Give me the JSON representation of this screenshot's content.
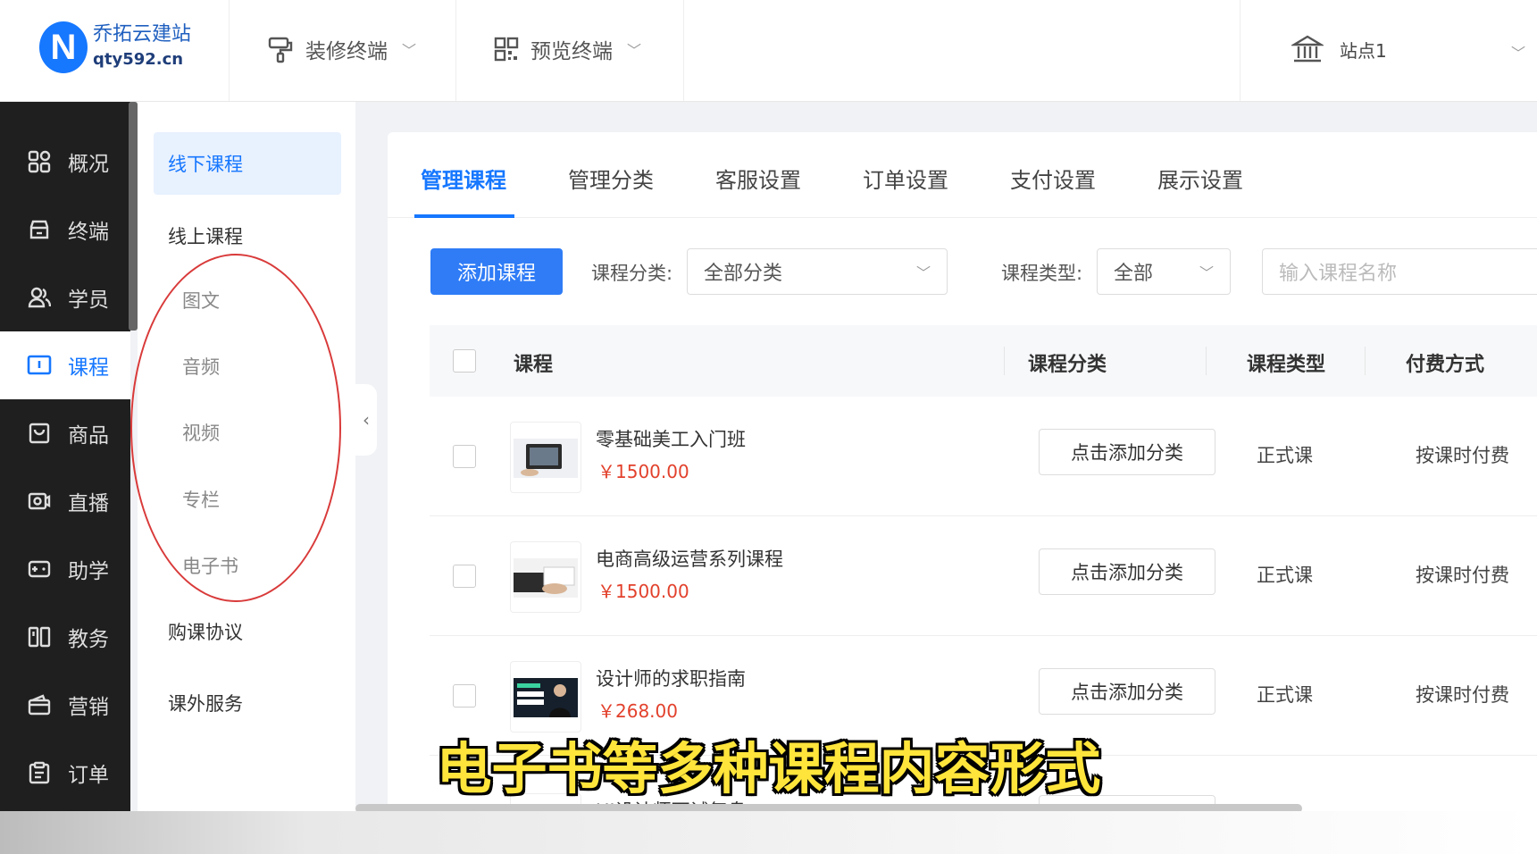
{
  "brand": {
    "name": "乔拓云建站",
    "domain": "qty592.cn",
    "mark": "N"
  },
  "topnav": [
    {
      "label": "装修终端",
      "icon": "paint-roller-icon"
    },
    {
      "label": "预览终端",
      "icon": "qr-code-icon"
    }
  ],
  "site": {
    "label": "站点1",
    "icon": "bank-icon"
  },
  "sidebar": [
    {
      "label": "概况",
      "icon": "grid-icon"
    },
    {
      "label": "终端",
      "icon": "terminal-icon"
    },
    {
      "label": "学员",
      "icon": "users-icon"
    },
    {
      "label": "课程",
      "icon": "course-icon",
      "active": true
    },
    {
      "label": "商品",
      "icon": "goods-icon"
    },
    {
      "label": "直播",
      "icon": "live-icon"
    },
    {
      "label": "助学",
      "icon": "gamepad-icon"
    },
    {
      "label": "教务",
      "icon": "book-icon"
    },
    {
      "label": "营销",
      "icon": "wallet-icon"
    },
    {
      "label": "订单",
      "icon": "clipboard-icon"
    }
  ],
  "subnav": {
    "offline": "线下课程",
    "online": "线上课程",
    "online_children": [
      "图文",
      "音频",
      "视频",
      "专栏",
      "电子书"
    ],
    "agreement": "购课协议",
    "service": "课外服务"
  },
  "tabs": [
    "管理课程",
    "管理分类",
    "客服设置",
    "订单设置",
    "支付设置",
    "展示设置"
  ],
  "filters": {
    "add_button": "添加课程",
    "category_label": "课程分类:",
    "category_value": "全部分类",
    "type_label": "课程类型:",
    "type_value": "全部",
    "search_placeholder": "输入课程名称"
  },
  "table": {
    "headers": [
      "课程",
      "课程分类",
      "课程类型",
      "付费方式"
    ],
    "rows": [
      {
        "title": "零基础美工入门班",
        "price": "￥1500.00",
        "category_btn": "点击添加分类",
        "type": "正式课",
        "pay": "按课时付费"
      },
      {
        "title": "电商高级运营系列课程",
        "price": "￥1500.00",
        "category_btn": "点击添加分类",
        "type": "正式课",
        "pay": "按课时付费"
      },
      {
        "title": "设计师的求职指南",
        "price": "￥268.00",
        "category_btn": "点击添加分类",
        "type": "正式课",
        "pay": "按课时付费"
      },
      {
        "title": "UI设计师面试复盘",
        "price": "",
        "category_btn": "",
        "type": "",
        "pay": ""
      }
    ]
  },
  "caption": "电子书等多种课程内容形式",
  "colors": {
    "accent": "#1677ff",
    "price": "#e2412c",
    "sidebar_bg": "#1f1f1f",
    "caption": "#ffe53b",
    "annotation": "#d93a3a"
  }
}
